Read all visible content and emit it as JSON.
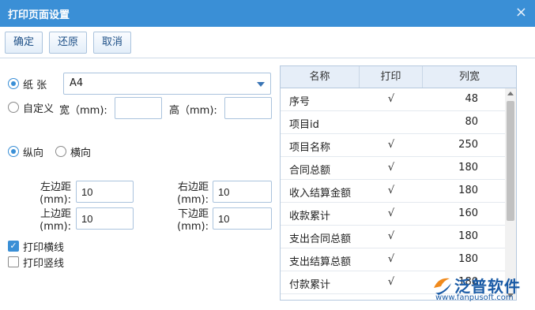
{
  "window": {
    "title": "打印页面设置",
    "close_symbol": "×"
  },
  "toolbar": {
    "confirm": "确定",
    "restore": "还原",
    "cancel": "取消"
  },
  "paper": {
    "paper_label": "纸 张",
    "paper_value": "A4",
    "custom_label": "自定义",
    "width_label": "宽（mm):",
    "height_label": "高（mm):",
    "width_value": "",
    "height_value": ""
  },
  "orientation": {
    "portrait_label": "纵向",
    "landscape_label": "横向",
    "selected": "portrait"
  },
  "margins": {
    "left_label_1": "左边距",
    "left_label_2": "(mm):",
    "left_value": "10",
    "right_label_1": "右边距",
    "right_label_2": "(mm):",
    "right_value": "10",
    "top_label_1": "上边距",
    "top_label_2": "(mm):",
    "top_value": "10",
    "bottom_label_1": "下边距",
    "bottom_label_2": "(mm):",
    "bottom_value": "10"
  },
  "options": {
    "print_hlines_label": "打印横线",
    "print_hlines_checked": true,
    "print_vlines_label": "打印竖线",
    "print_vlines_checked": false
  },
  "columns_grid": {
    "headers": {
      "name": "名称",
      "print": "打印",
      "width": "列宽"
    },
    "rows": [
      {
        "name": "序号",
        "print": "√",
        "width": "48"
      },
      {
        "name": "项目id",
        "print": "",
        "width": "80"
      },
      {
        "name": "项目名称",
        "print": "√",
        "width": "250"
      },
      {
        "name": "合同总额",
        "print": "√",
        "width": "180"
      },
      {
        "name": "收入结算金额",
        "print": "√",
        "width": "180"
      },
      {
        "name": "收款累计",
        "print": "√",
        "width": "160"
      },
      {
        "name": "支出合同总额",
        "print": "√",
        "width": "180"
      },
      {
        "name": "支出结算总额",
        "print": "√",
        "width": "180"
      },
      {
        "name": "付款累计",
        "print": "√",
        "width": "180"
      },
      {
        "name": "",
        "print": "",
        "width": ""
      }
    ]
  },
  "watermark": {
    "brand": "泛普软件",
    "site": "www.fanpusoft.com"
  },
  "colors": {
    "accent": "#3a8fd6",
    "title_bar": "#3a8fd6",
    "brand": "#1a5ba6",
    "logo_orange": "#f08a1c"
  },
  "icons": {
    "close": "close-icon",
    "select_arrow": "chevron-down-icon",
    "check": "check-icon"
  }
}
